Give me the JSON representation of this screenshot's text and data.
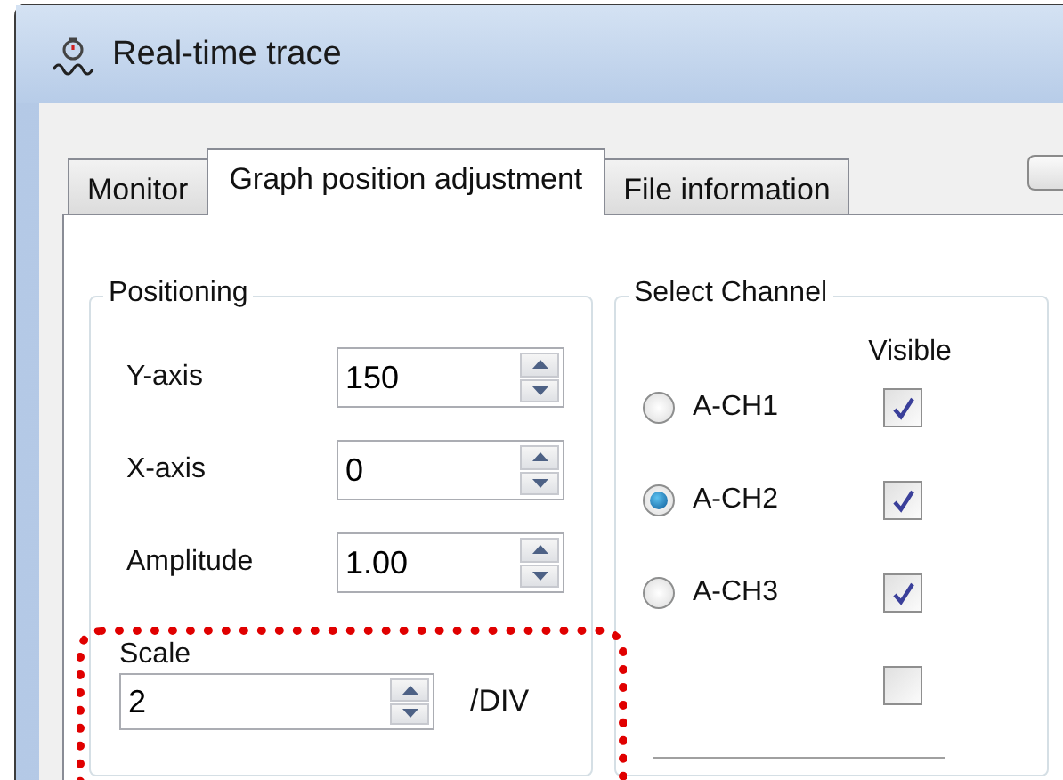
{
  "window": {
    "title": "Real-time trace"
  },
  "tabs": [
    {
      "label": "Monitor",
      "selected": false
    },
    {
      "label": "Graph position adjustment",
      "selected": true
    },
    {
      "label": "File information",
      "selected": false
    }
  ],
  "positioning": {
    "title": "Positioning",
    "fields": [
      {
        "label": "Y-axis",
        "value": "150"
      },
      {
        "label": "X-axis",
        "value": "0"
      },
      {
        "label": "Amplitude",
        "value": "1.00"
      }
    ]
  },
  "scale": {
    "label": "Scale",
    "value": "2",
    "unit": "/DIV"
  },
  "select_channel": {
    "title": "Select Channel",
    "visible_header": "Visible",
    "channels": [
      {
        "name": "A-CH1",
        "selected": false,
        "visible": true
      },
      {
        "name": "A-CH2",
        "selected": true,
        "visible": true
      },
      {
        "name": "A-CH3",
        "selected": false,
        "visible": true
      }
    ],
    "extra_checkbox": {
      "checked": false
    }
  }
}
